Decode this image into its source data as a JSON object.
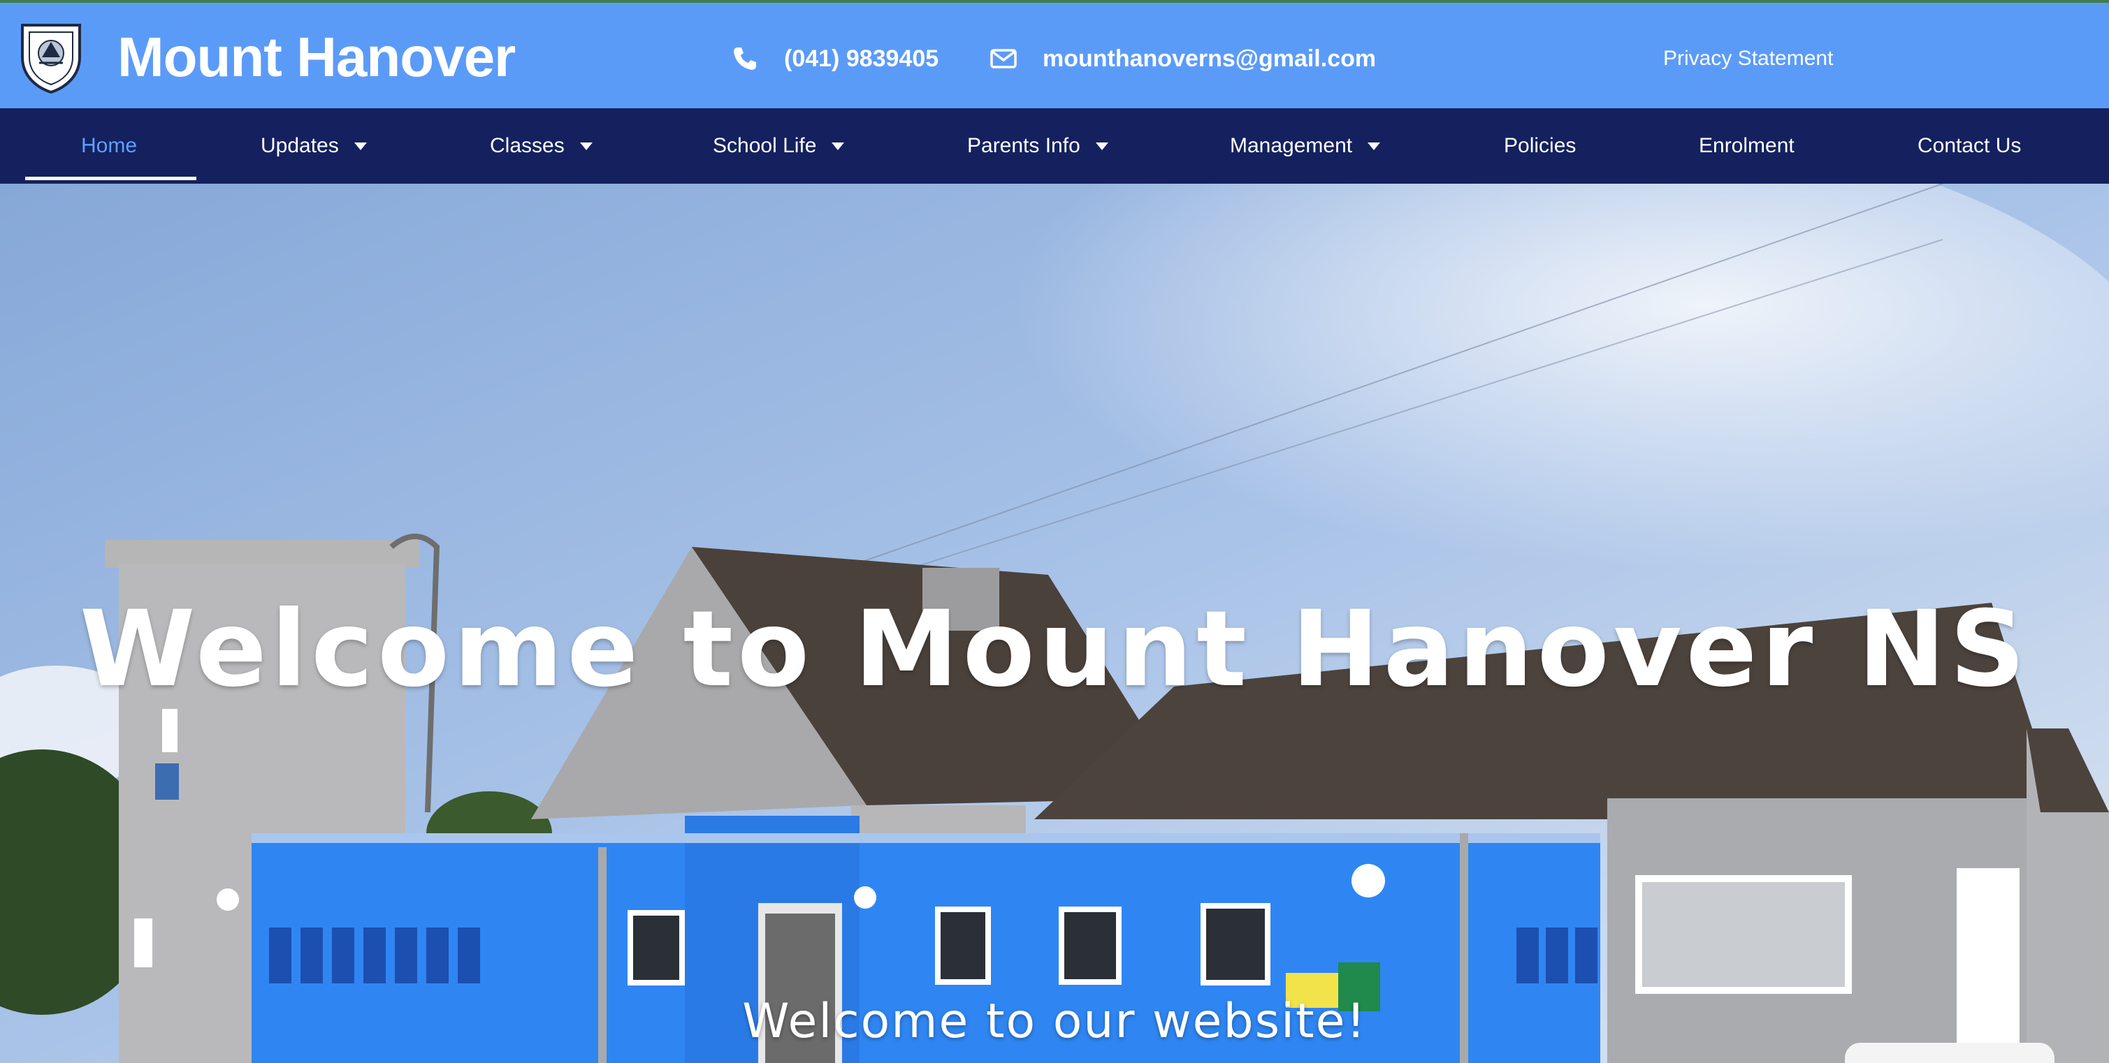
{
  "header": {
    "site_title": "Mount Hanover",
    "phone": "(041) 9839405",
    "email": "mounthanoverns@gmail.com",
    "privacy_link": "Privacy Statement",
    "logo_icon": "school-crest-icon",
    "phone_icon": "phone-icon",
    "email_icon": "envelope-icon"
  },
  "nav": {
    "items": [
      {
        "label": "Home",
        "active": true,
        "dropdown": false
      },
      {
        "label": "Updates",
        "active": false,
        "dropdown": true
      },
      {
        "label": "Classes",
        "active": false,
        "dropdown": true
      },
      {
        "label": "School Life",
        "active": false,
        "dropdown": true
      },
      {
        "label": "Parents Info",
        "active": false,
        "dropdown": true
      },
      {
        "label": "Management",
        "active": false,
        "dropdown": true
      },
      {
        "label": "Policies",
        "active": false,
        "dropdown": false
      },
      {
        "label": "Enrolment",
        "active": false,
        "dropdown": false
      },
      {
        "label": "Contact Us",
        "active": false,
        "dropdown": false
      }
    ]
  },
  "hero": {
    "heading": "Welcome to Mount Hanover NS",
    "subheading": "Welcome to our website!"
  },
  "colors": {
    "header_bg": "#5b9bf8",
    "nav_bg": "#14215e",
    "active_nav": "#5ea0ff",
    "building_blue": "#2f86f2"
  }
}
